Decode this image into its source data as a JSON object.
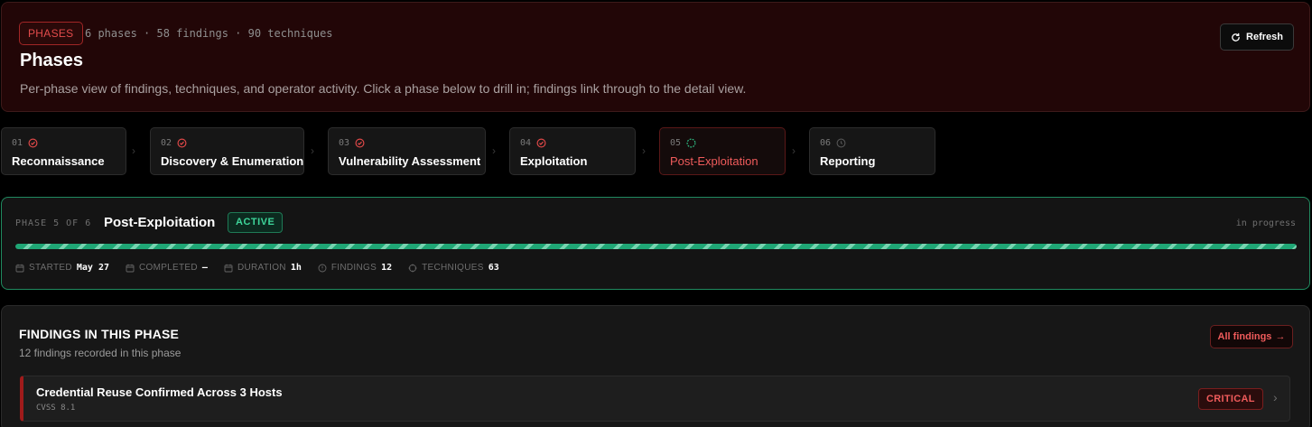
{
  "header": {
    "badge": "PHASES",
    "meta": "6 phases · 58 findings · 90 techniques",
    "title": "Phases",
    "description": "Per-phase view of findings, techniques, and operator activity. Click a phase below to drill in; findings link through to the detail view.",
    "refresh_label": "Refresh"
  },
  "phases": [
    {
      "num": "01",
      "label": "Reconnaissance",
      "status": "done"
    },
    {
      "num": "02",
      "label": "Discovery & Enumeration",
      "status": "done"
    },
    {
      "num": "03",
      "label": "Vulnerability Assessment",
      "status": "done"
    },
    {
      "num": "04",
      "label": "Exploitation",
      "status": "done"
    },
    {
      "num": "05",
      "label": "Post-Exploitation",
      "status": "active"
    },
    {
      "num": "06",
      "label": "Reporting",
      "status": "pending"
    }
  ],
  "active_phase": {
    "kicker": "PHASE 5 OF 6",
    "name": "Post-Exploitation",
    "status": "ACTIVE",
    "progress_text": "in progress",
    "progress": 1.0,
    "stats": {
      "started_label": "STARTED",
      "started": "May 27",
      "completed_label": "COMPLETED",
      "completed": "—",
      "duration_label": "DURATION",
      "duration": "1h",
      "findings_label": "FINDINGS",
      "findings": "12",
      "techniques_label": "TECHNIQUES",
      "techniques": "63"
    }
  },
  "findings": {
    "heading": "FINDINGS IN THIS PHASE",
    "subheading": "12 findings recorded in this phase",
    "all_label": "All findings",
    "items": [
      {
        "title": "Credential Reuse Confirmed Across 3 Hosts",
        "cvss": "CVSS 8.1",
        "severity": "CRITICAL"
      }
    ]
  },
  "colors": {
    "accent_red": "#ef5b5b",
    "accent_green": "#3ed59a",
    "background": "#000000"
  }
}
